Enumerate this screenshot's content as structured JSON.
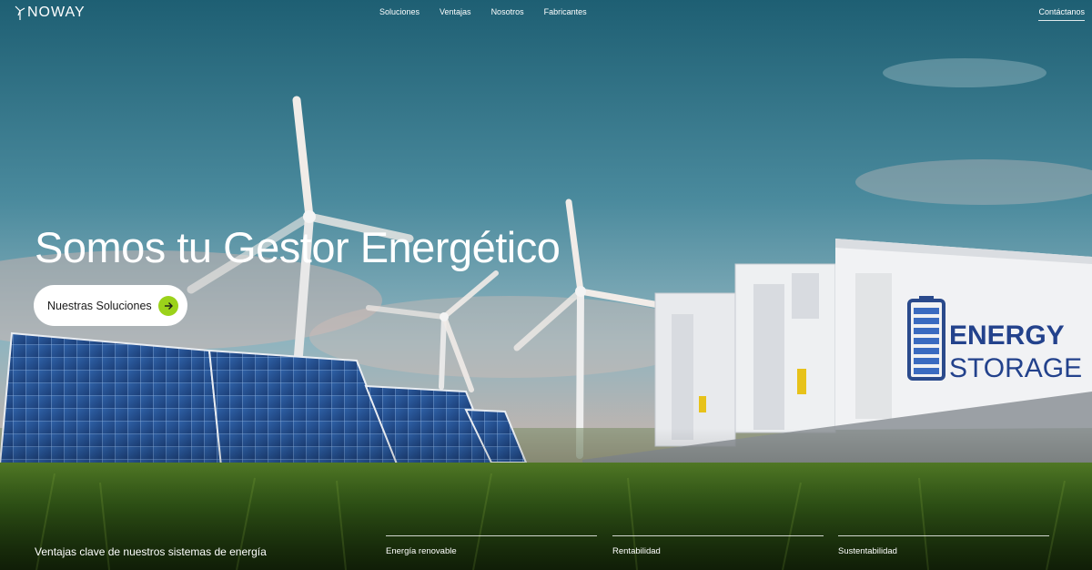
{
  "brand": {
    "name": "NOWAY"
  },
  "nav": {
    "items": [
      "Soluciones",
      "Ventajas",
      "Nosotros",
      "Fabricantes"
    ],
    "contact": "Contáctanos"
  },
  "hero": {
    "headline": "Somos tu Gestor Energético",
    "cta_label": "Nuestras Soluciones",
    "storage_sign_line1": "ENERGY",
    "storage_sign_line2": "STORAGE"
  },
  "benefits": {
    "title": "Ventajas clave de nuestros sistemas de energía",
    "items": [
      "Energía renovable",
      "Rentabilidad",
      "Sustentabilidad"
    ]
  },
  "colors": {
    "accent": "#9bd21a",
    "button_bg": "#ffffff",
    "text": "#ffffff"
  }
}
